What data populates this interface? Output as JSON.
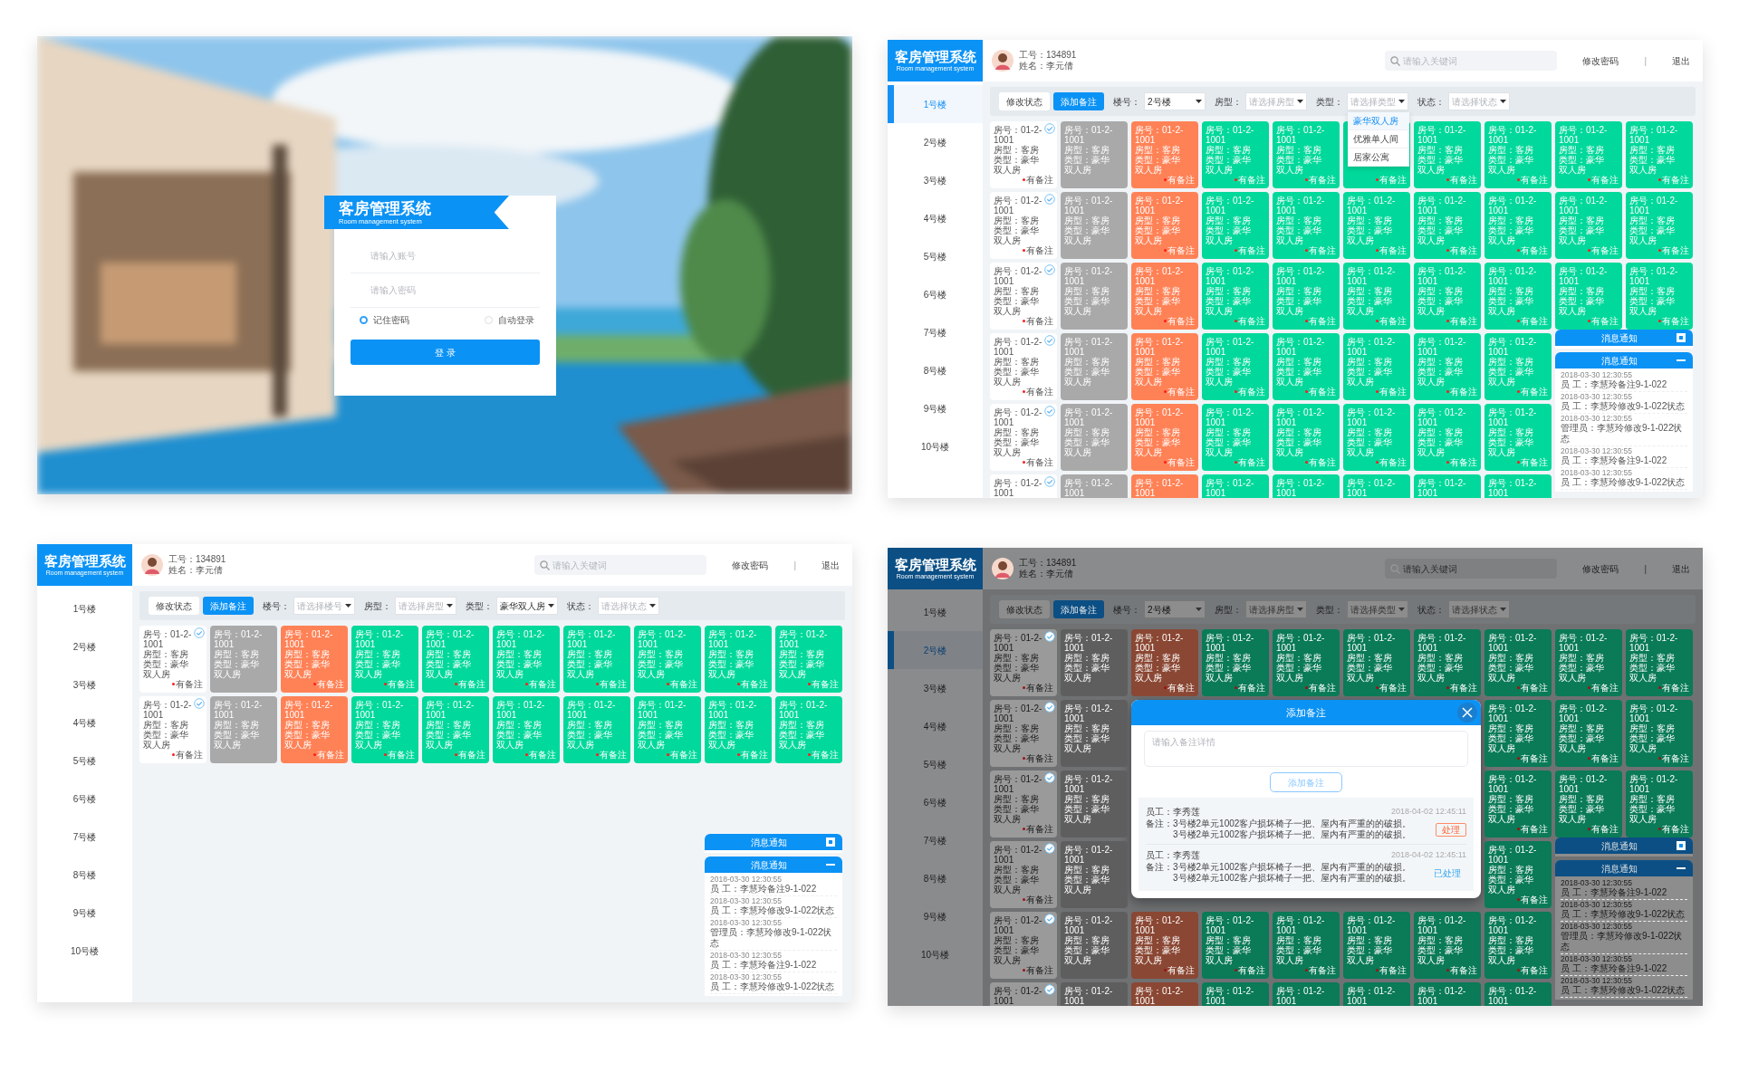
{
  "screens": [
    {
      "kind": "login",
      "title": "客房管理系统",
      "subtitle": "Room management system",
      "fields": [
        {
          "placeholder": "请输入账号"
        },
        {
          "placeholder": "请输入密码"
        }
      ],
      "options": [
        {
          "label": "记住密码",
          "checked": true
        },
        {
          "label": "自动登录",
          "checked": false
        }
      ],
      "button": "登 录"
    },
    {
      "kind": "dashboard",
      "header": {
        "title": "客房管理系统",
        "subtitle": "Room management system",
        "staff_id": "工号：134891",
        "staff_name": "姓名：李元倩",
        "search_placeholder": "请输入关键词",
        "links": [
          "修改密码",
          "|",
          "退出"
        ]
      },
      "floors": [
        {
          "label": "1号楼",
          "selected": true
        },
        {
          "label": "2号楼",
          "selected": false
        },
        {
          "label": "3号楼",
          "selected": false
        },
        {
          "label": "4号楼",
          "selected": false
        },
        {
          "label": "5号楼",
          "selected": false
        },
        {
          "label": "6号楼",
          "selected": false
        },
        {
          "label": "7号楼",
          "selected": false
        },
        {
          "label": "8号楼",
          "selected": false
        },
        {
          "label": "9号楼",
          "selected": false
        },
        {
          "label": "10号楼",
          "selected": false
        }
      ],
      "toolbar": {
        "buttons": [
          {
            "label": "修改状态",
            "primary": false
          },
          {
            "label": "添加备注",
            "primary": true
          }
        ],
        "filters": [
          {
            "label": "楼号：",
            "value": "2号楼"
          },
          {
            "label": "房型：",
            "placeholder": "请选择房型"
          },
          {
            "label": "类型：",
            "placeholder": "请选择类型",
            "options": [
              {
                "label": "豪华双人房",
                "selected": true
              },
              {
                "label": "优雅单人间",
                "selected": false
              },
              {
                "label": "居家公寓",
                "selected": false
              }
            ]
          },
          {
            "label": "状态：",
            "placeholder": "请选择状态"
          }
        ]
      },
      "rooms": [
        [
          {
            "color": "#ffffff",
            "checked": true,
            "room": "房号：01-2-1001",
            "type": "房型：客房",
            "category": "类型：豪华双人房",
            "note": "有备注"
          },
          {
            "color": "#a9a9a9",
            "checked": false,
            "room": "房号：01-2-1001",
            "type": "房型：客房",
            "category": "类型：豪华双人房"
          },
          {
            "color": "#ff8257",
            "checked": false,
            "room": "房号：01-2-1001",
            "type": "房型：客房",
            "category": "类型：豪华双人房",
            "note": "有备注"
          },
          {
            "color": "#00d99b",
            "checked": false,
            "room": "房号：01-2-1001",
            "type": "房型：客房",
            "category": "类型：豪华双人房",
            "note": "有备注"
          },
          {
            "color": "#00d99b",
            "checked": false,
            "room": "房号：01-2-1001",
            "type": "房型：客房",
            "category": "类型：豪华双人房",
            "note": "有备注"
          },
          {
            "color": "#00d99b",
            "note": "有备注"
          },
          {
            "color": "#00d99b",
            "checked": false,
            "room": "房号：01-2-1001",
            "type": "房型：客房",
            "category": "类型：豪华双人房",
            "note": "有备注"
          },
          {
            "color": "#00d99b",
            "checked": false,
            "room": "房号：01-2-1001",
            "type": "房型：客房",
            "category": "类型：豪华双人房",
            "note": "有备注"
          },
          {
            "color": "#00d99b",
            "checked": false,
            "room": "房号：01-2-1001",
            "type": "房型：客房",
            "category": "类型：豪华双人房",
            "note": "有备注"
          },
          {
            "color": "#00d99b",
            "checked": false,
            "room": "房号：01-2-1001",
            "type": "房型：客房",
            "category": "类型：豪华双人房",
            "note": "有备注"
          }
        ],
        [
          {
            "color": "#ffffff",
            "checked": true,
            "room": "房号：01-2-1001",
            "type": "房型：客房",
            "category": "类型：豪华双人房",
            "note": "有备注"
          },
          {
            "color": "#a9a9a9",
            "checked": false,
            "room": "房号：01-2-1001",
            "type": "房型：客房",
            "category": "类型：豪华双人房"
          },
          {
            "color": "#ff8257",
            "checked": false,
            "room": "房号：01-2-1001",
            "type": "房型：客房",
            "category": "类型：豪华双人房",
            "note": "有备注"
          },
          {
            "color": "#00d99b",
            "checked": false,
            "room": "房号：01-2-1001",
            "type": "房型：客房",
            "category": "类型：豪华双人房",
            "note": "有备注"
          },
          {
            "color": "#00d99b",
            "checked": false,
            "room": "房号：01-2-1001",
            "type": "房型：客房",
            "category": "类型：豪华双人房",
            "note": "有备注"
          },
          {
            "color": "#00d99b",
            "checked": false,
            "room": "房号：01-2-1001",
            "type": "房型：客房",
            "category": "类型：豪华双人房",
            "note": "有备注"
          },
          {
            "color": "#00d99b",
            "checked": false,
            "room": "房号：01-2-1001",
            "type": "房型：客房",
            "category": "类型：豪华双人房",
            "note": "有备注"
          },
          {
            "color": "#00d99b",
            "checked": false,
            "room": "房号：01-2-1001",
            "type": "房型：客房",
            "category": "类型：豪华双人房",
            "note": "有备注"
          },
          {
            "color": "#00d99b",
            "checked": false,
            "room": "房号：01-2-1001",
            "type": "房型：客房",
            "category": "类型：豪华双人房",
            "note": "有备注"
          },
          {
            "color": "#00d99b",
            "checked": false,
            "room": "房号：01-2-1001",
            "type": "房型：客房",
            "category": "类型：豪华双人房",
            "note": "有备注"
          }
        ],
        [
          {
            "color": "#ffffff",
            "checked": true,
            "room": "房号：01-2-1001",
            "type": "房型：客房",
            "category": "类型：豪华双人房",
            "note": "有备注"
          },
          {
            "color": "#a9a9a9",
            "checked": false,
            "room": "房号：01-2-1001",
            "type": "房型：客房",
            "category": "类型：豪华双人房"
          },
          {
            "color": "#ff8257",
            "checked": false,
            "room": "房号：01-2-1001",
            "type": "房型：客房",
            "category": "类型：豪华双人房",
            "note": "有备注"
          },
          {
            "color": "#00d99b",
            "checked": false,
            "room": "房号：01-2-1001",
            "type": "房型：客房",
            "category": "类型：豪华双人房",
            "note": "有备注"
          },
          {
            "color": "#00d99b",
            "checked": false,
            "room": "房号：01-2-1001",
            "type": "房型：客房",
            "category": "类型：豪华双人房",
            "note": "有备注"
          },
          {
            "color": "#00d99b",
            "checked": false,
            "room": "房号：01-2-1001",
            "type": "房型：客房",
            "category": "类型：豪华双人房",
            "note": "有备注"
          },
          {
            "color": "#00d99b",
            "checked": false,
            "room": "房号：01-2-1001",
            "type": "房型：客房",
            "category": "类型：豪华双人房",
            "note": "有备注"
          },
          {
            "color": "#00d99b",
            "checked": false,
            "room": "房号：01-2-1001",
            "type": "房型：客房",
            "category": "类型：豪华双人房",
            "note": "有备注"
          },
          {
            "color": "#00d99b",
            "checked": false,
            "room": "房号：01-2-1001",
            "type": "房型：客房",
            "category": "类型：豪华双人房",
            "note": "有备注"
          },
          {
            "color": "#00d99b",
            "checked": false,
            "room": "房号：01-2-1001",
            "type": "房型：客房",
            "category": "类型：豪华双人房",
            "note": "有备注"
          }
        ],
        [
          {
            "color": "#ffffff",
            "checked": true,
            "room": "房号：01-2-1001",
            "type": "房型：客房",
            "category": "类型：豪华双人房",
            "note": "有备注"
          },
          {
            "color": "#a9a9a9",
            "checked": false,
            "room": "房号：01-2-1001",
            "type": "房型：客房",
            "category": "类型：豪华双人房"
          },
          {
            "color": "#ff8257",
            "checked": false,
            "room": "房号：01-2-1001",
            "type": "房型：客房",
            "category": "类型：豪华双人房",
            "note": "有备注"
          },
          {
            "color": "#00d99b",
            "checked": false,
            "room": "房号：01-2-1001",
            "type": "房型：客房",
            "category": "类型：豪华双人房",
            "note": "有备注"
          },
          {
            "color": "#00d99b",
            "checked": false,
            "room": "房号：01-2-1001",
            "type": "房型：客房",
            "category": "类型：豪华双人房",
            "note": "有备注"
          },
          {
            "color": "#00d99b",
            "checked": false,
            "room": "房号：01-2-1001",
            "type": "房型：客房",
            "category": "类型：豪华双人房",
            "note": "有备注"
          },
          {
            "color": "#00d99b",
            "checked": false,
            "room": "房号：01-2-1001",
            "type": "房型：客房",
            "category": "类型：豪华双人房",
            "note": "有备注"
          },
          {
            "color": "#00d99b",
            "checked": false,
            "room": "房号：01-2-1001",
            "type": "房型：客房",
            "category": "类型：豪华双人房",
            "note": "有备注"
          }
        ],
        [
          {
            "color": "#ffffff",
            "checked": true,
            "room": "房号：01-2-1001",
            "type": "房型：客房",
            "category": "类型：豪华双人房",
            "note": "有备注"
          },
          {
            "color": "#a9a9a9",
            "checked": false,
            "room": "房号：01-2-1001",
            "type": "房型：客房",
            "category": "类型：豪华双人房"
          },
          {
            "color": "#ff8257",
            "checked": false,
            "room": "房号：01-2-1001",
            "type": "房型：客房",
            "category": "类型：豪华双人房",
            "note": "有备注"
          },
          {
            "color": "#00d99b",
            "checked": false,
            "room": "房号：01-2-1001",
            "type": "房型：客房",
            "category": "类型：豪华双人房",
            "note": "有备注"
          },
          {
            "color": "#00d99b",
            "checked": false,
            "room": "房号：01-2-1001",
            "type": "房型：客房",
            "category": "类型：豪华双人房",
            "note": "有备注"
          },
          {
            "color": "#00d99b",
            "checked": false,
            "room": "房号：01-2-1001",
            "type": "房型：客房",
            "category": "类型：豪华双人房",
            "note": "有备注"
          },
          {
            "color": "#00d99b",
            "checked": false,
            "room": "房号：01-2-1001",
            "type": "房型：客房",
            "category": "类型：豪华双人房",
            "note": "有备注"
          },
          {
            "color": "#00d99b",
            "checked": false,
            "room": "房号：01-2-1001",
            "type": "房型：客房",
            "category": "类型：豪华双人房",
            "note": "有备注"
          }
        ],
        [
          {
            "color": "#ffffff",
            "checked": true,
            "room": "房号：01-2-1001"
          },
          {
            "color": "#a9a9a9",
            "checked": false,
            "room": "房号：01-2-1001"
          },
          {
            "color": "#ff8257",
            "checked": false,
            "room": "房号：01-2-1001"
          },
          {
            "color": "#00d99b",
            "checked": false,
            "room": "房号：01-2-1001"
          },
          {
            "color": "#00d99b",
            "checked": false,
            "room": "房号：01-2-1001"
          },
          {
            "color": "#00d99b",
            "checked": false,
            "room": "房号：01-2-1001"
          },
          {
            "color": "#00d99b",
            "checked": false,
            "room": "房号：01-2-1001"
          },
          {
            "color": "#00d99b",
            "checked": false,
            "room": "房号：01-2-1001"
          }
        ]
      ],
      "notices": [
        {
          "title": "消息通知",
          "expanded": false
        },
        {
          "title": "消息通知",
          "expanded": true,
          "entries": [
            {
              "time": "2018-03-30 12:30:55",
              "text": "员 工：李慧玲备注9-1-022"
            },
            {
              "time": "2018-03-30 12:30:55",
              "text": "员 工：李慧玲修改9-1-022状态"
            },
            {
              "time": "2018-03-30 12:30:55",
              "text": "管理员：李慧玲修改9-1-022状态"
            },
            {
              "time": "2018-03-30 12:30:55",
              "text": "员 工：李慧玲备注9-1-022"
            },
            {
              "time": "2018-03-30 12:30:55",
              "text": "员 工：李慧玲修改9-1-022状态"
            }
          ]
        }
      ]
    },
    {
      "kind": "dashboard",
      "header": {
        "title": "客房管理系统",
        "subtitle": "Room management system",
        "staff_id": "工号：134891",
        "staff_name": "姓名：李元倩",
        "search_placeholder": "请输入关键词",
        "links": [
          "修改密码",
          "|",
          "退出"
        ]
      },
      "floors": [
        {
          "label": "1号楼",
          "selected": false
        },
        {
          "label": "2号楼",
          "selected": false
        },
        {
          "label": "3号楼",
          "selected": false
        },
        {
          "label": "4号楼",
          "selected": false
        },
        {
          "label": "5号楼",
          "selected": false
        },
        {
          "label": "6号楼",
          "selected": false
        },
        {
          "label": "7号楼",
          "selected": false
        },
        {
          "label": "8号楼",
          "selected": false
        },
        {
          "label": "9号楼",
          "selected": false
        },
        {
          "label": "10号楼",
          "selected": false
        }
      ],
      "toolbar": {
        "buttons": [
          {
            "label": "修改状态",
            "primary": false
          },
          {
            "label": "添加备注",
            "primary": true
          }
        ],
        "filters": [
          {
            "label": "楼号：",
            "placeholder": "请选择楼号"
          },
          {
            "label": "房型：",
            "placeholder": "请选择房型"
          },
          {
            "label": "类型：",
            "value": "豪华双人房"
          },
          {
            "label": "状态：",
            "placeholder": "请选择状态"
          }
        ]
      },
      "rooms": [
        [
          {
            "color": "#ffffff",
            "checked": true,
            "room": "房号：01-2-1001",
            "type": "房型：客房",
            "category": "类型：豪华双人房",
            "note": "有备注"
          },
          {
            "color": "#a9a9a9",
            "checked": false,
            "room": "房号：01-2-1001",
            "type": "房型：客房",
            "category": "类型：豪华双人房"
          },
          {
            "color": "#ff8257",
            "checked": false,
            "room": "房号：01-2-1001",
            "type": "房型：客房",
            "category": "类型：豪华双人房",
            "note": "有备注"
          },
          {
            "color": "#00d99b",
            "checked": false,
            "room": "房号：01-2-1001",
            "type": "房型：客房",
            "category": "类型：豪华双人房",
            "note": "有备注"
          },
          {
            "color": "#00d99b",
            "checked": false,
            "room": "房号：01-2-1001",
            "type": "房型：客房",
            "category": "类型：豪华双人房",
            "note": "有备注"
          },
          {
            "color": "#00d99b",
            "checked": false,
            "room": "房号：01-2-1001",
            "type": "房型：客房",
            "category": "类型：豪华双人房",
            "note": "有备注"
          },
          {
            "color": "#00d99b",
            "checked": false,
            "room": "房号：01-2-1001",
            "type": "房型：客房",
            "category": "类型：豪华双人房",
            "note": "有备注"
          },
          {
            "color": "#00d99b",
            "checked": false,
            "room": "房号：01-2-1001",
            "type": "房型：客房",
            "category": "类型：豪华双人房",
            "note": "有备注"
          },
          {
            "color": "#00d99b",
            "checked": false,
            "room": "房号：01-2-1001",
            "type": "房型：客房",
            "category": "类型：豪华双人房",
            "note": "有备注"
          },
          {
            "color": "#00d99b",
            "checked": false,
            "room": "房号：01-2-1001",
            "type": "房型：客房",
            "category": "类型：豪华双人房",
            "note": "有备注"
          }
        ],
        [
          {
            "color": "#ffffff",
            "checked": true,
            "room": "房号：01-2-1001",
            "type": "房型：客房",
            "category": "类型：豪华双人房",
            "note": "有备注"
          },
          {
            "color": "#a9a9a9",
            "checked": false,
            "room": "房号：01-2-1001",
            "type": "房型：客房",
            "category": "类型：豪华双人房"
          },
          {
            "color": "#ff8257",
            "checked": false,
            "room": "房号：01-2-1001",
            "type": "房型：客房",
            "category": "类型：豪华双人房",
            "note": "有备注"
          },
          {
            "color": "#00d99b",
            "checked": false,
            "room": "房号：01-2-1001",
            "type": "房型：客房",
            "category": "类型：豪华双人房",
            "note": "有备注"
          },
          {
            "color": "#00d99b",
            "checked": false,
            "room": "房号：01-2-1001",
            "type": "房型：客房",
            "category": "类型：豪华双人房",
            "note": "有备注"
          },
          {
            "color": "#00d99b",
            "checked": false,
            "room": "房号：01-2-1001",
            "type": "房型：客房",
            "category": "类型：豪华双人房",
            "note": "有备注"
          },
          {
            "color": "#00d99b",
            "checked": false,
            "room": "房号：01-2-1001",
            "type": "房型：客房",
            "category": "类型：豪华双人房",
            "note": "有备注"
          },
          {
            "color": "#00d99b",
            "checked": false,
            "room": "房号：01-2-1001",
            "type": "房型：客房",
            "category": "类型：豪华双人房",
            "note": "有备注"
          },
          {
            "color": "#00d99b",
            "checked": false,
            "room": "房号：01-2-1001",
            "type": "房型：客房",
            "category": "类型：豪华双人房",
            "note": "有备注"
          },
          {
            "color": "#00d99b",
            "checked": false,
            "room": "房号：01-2-1001",
            "type": "房型：客房",
            "category": "类型：豪华双人房",
            "note": "有备注"
          }
        ]
      ],
      "notices": [
        {
          "title": "消息通知",
          "expanded": false
        },
        {
          "title": "消息通知",
          "expanded": true,
          "entries": [
            {
              "time": "2018-03-30 12:30:55",
              "text": "员 工：李慧玲备注9-1-022"
            },
            {
              "time": "2018-03-30 12:30:55",
              "text": "员 工：李慧玲修改9-1-022状态"
            },
            {
              "time": "2018-03-30 12:30:55",
              "text": "管理员：李慧玲修改9-1-022状态"
            },
            {
              "time": "2018-03-30 12:30:55",
              "text": "员 工：李慧玲备注9-1-022"
            },
            {
              "time": "2018-03-30 12:30:55",
              "text": "员 工：李慧玲修改9-1-022状态"
            }
          ]
        }
      ]
    },
    {
      "kind": "dashboard",
      "dimmed": true,
      "header": {
        "title": "客房管理系统",
        "subtitle": "Room management system",
        "staff_id": "工号：134891",
        "staff_name": "姓名：李元倩",
        "search_placeholder": "请输入关键词",
        "links": [
          "修改密码",
          "|",
          "退出"
        ]
      },
      "floors": [
        {
          "label": "1号楼",
          "selected": false
        },
        {
          "label": "2号楼",
          "selected": true
        },
        {
          "label": "3号楼",
          "selected": false
        },
        {
          "label": "4号楼",
          "selected": false
        },
        {
          "label": "5号楼",
          "selected": false
        },
        {
          "label": "6号楼",
          "selected": false
        },
        {
          "label": "7号楼",
          "selected": false
        },
        {
          "label": "8号楼",
          "selected": false
        },
        {
          "label": "9号楼",
          "selected": false
        },
        {
          "label": "10号楼",
          "selected": false
        }
      ],
      "toolbar": {
        "buttons": [
          {
            "label": "修改状态",
            "primary": false
          },
          {
            "label": "添加备注",
            "primary": true
          }
        ],
        "filters": [
          {
            "label": "楼号：",
            "value": "2号楼"
          },
          {
            "label": "房型：",
            "placeholder": "请选择房型"
          },
          {
            "label": "类型：",
            "placeholder": "请选择类型"
          },
          {
            "label": "状态：",
            "placeholder": "请选择状态"
          }
        ]
      },
      "rooms": [
        [
          {
            "color": "#9a9a9a",
            "checked": true,
            "room": "房号：01-2-1001",
            "type": "房型：客房",
            "category": "类型：豪华双人房",
            "note": "有备注"
          },
          {
            "color": "#5e5e5e",
            "checked": false,
            "room": "房号：01-2-1001",
            "type": "房型：客房",
            "category": "类型：豪华双人房"
          },
          {
            "color": "#8a4733",
            "checked": false,
            "room": "房号：01-2-1001",
            "type": "房型：客房",
            "category": "类型：豪华双人房",
            "note": "有备注"
          },
          {
            "color": "#0a7a57",
            "checked": false,
            "room": "房号：01-2-1001",
            "type": "房型：客房",
            "category": "类型：豪华双人房",
            "note": "有备注"
          },
          {
            "color": "#0a7a57",
            "checked": false,
            "room": "房号：01-2-1001",
            "type": "房型：客房",
            "category": "类型：豪华双人房",
            "note": "有备注"
          },
          {
            "color": "#0a7a57",
            "checked": false,
            "room": "房号：01-2-1001",
            "type": "房型：客房",
            "category": "类型：豪华双人房",
            "note": "有备注"
          },
          {
            "color": "#0a7a57",
            "checked": false,
            "room": "房号：01-2-1001",
            "type": "房型：客房",
            "category": "类型：豪华双人房",
            "note": "有备注"
          },
          {
            "color": "#0a7a57",
            "checked": false,
            "room": "房号：01-2-1001",
            "type": "房型：客房",
            "category": "类型：豪华双人房",
            "note": "有备注"
          },
          {
            "color": "#0a7a57",
            "checked": false,
            "room": "房号：01-2-1001",
            "type": "房型：客房",
            "category": "类型：豪华双人房",
            "note": "有备注"
          },
          {
            "color": "#0a7a57",
            "checked": false,
            "room": "房号：01-2-1001",
            "type": "房型：客房",
            "category": "类型：豪华双人房",
            "note": "有备注"
          }
        ],
        [
          {
            "color": "#9a9a9a",
            "checked": true,
            "room": "房号：01-2-1001",
            "type": "房型：客房",
            "category": "类型：豪华双人房",
            "note": "有备注"
          },
          {
            "color": "#5e5e5e",
            "checked": false,
            "room": "房号：01-2-1001",
            "type": "房型：客房",
            "category": "类型：豪华双人房"
          },
          {
            "color": "#0a7a57",
            "checked": false,
            "room": "房号：01-2-1001",
            "type": "房型：客房",
            "category": "类型：豪华双人房",
            "note": "有备注"
          },
          {
            "color": "#0a7a57",
            "checked": false,
            "room": "房号：01-2-1001",
            "type": "房型：客房",
            "category": "类型：豪华双人房",
            "note": "有备注"
          },
          {
            "color": "#0a7a57",
            "checked": false,
            "room": "房号：01-2-1001",
            "type": "房型：客房",
            "category": "类型：豪华双人房",
            "note": "有备注"
          }
        ],
        [
          {
            "color": "#9a9a9a",
            "checked": true,
            "room": "房号：01-2-1001",
            "type": "房型：客房",
            "category": "类型：豪华双人房",
            "note": "有备注"
          },
          {
            "color": "#5e5e5e",
            "checked": false,
            "room": "房号：01-2-1001",
            "type": "房型：客房",
            "category": "类型：豪华双人房"
          },
          {
            "color": "#0a7a57",
            "checked": false,
            "room": "房号：01-2-1001",
            "type": "房型：客房",
            "category": "类型：豪华双人房",
            "note": "有备注"
          },
          {
            "color": "#0a7a57",
            "checked": false,
            "room": "房号：01-2-1001",
            "type": "房型：客房",
            "category": "类型：豪华双人房",
            "note": "有备注"
          },
          {
            "color": "#0a7a57",
            "checked": false,
            "room": "房号：01-2-1001",
            "type": "房型：客房",
            "category": "类型：豪华双人房",
            "note": "有备注"
          }
        ],
        [
          {
            "color": "#9a9a9a",
            "checked": true,
            "room": "房号：01-2-1001",
            "type": "房型：客房",
            "category": "类型：豪华双人房",
            "note": "有备注"
          },
          {
            "color": "#5e5e5e",
            "checked": false,
            "room": "房号：01-2-1001",
            "type": "房型：客房",
            "category": "类型：豪华双人房"
          },
          {
            "color": "#0a7a57",
            "checked": false,
            "room": "房号：01-2-1001",
            "type": "房型：客房",
            "category": "类型：豪华双人房",
            "note": "有备注"
          }
        ],
        [
          {
            "color": "#9a9a9a",
            "checked": true,
            "room": "房号：01-2-1001",
            "type": "房型：客房",
            "category": "类型：豪华双人房",
            "note": "有备注"
          },
          {
            "color": "#5e5e5e",
            "checked": false,
            "room": "房号：01-2-1001",
            "type": "房型：客房",
            "category": "类型：豪华双人房"
          },
          {
            "color": "#8a4733",
            "checked": false,
            "room": "房号：01-2-1001",
            "type": "房型：客房",
            "category": "类型：豪华双人房",
            "note": "有备注"
          },
          {
            "color": "#0a7a57",
            "checked": false,
            "room": "房号：01-2-1001",
            "type": "房型：客房",
            "category": "类型：豪华双人房",
            "note": "有备注"
          },
          {
            "color": "#0a7a57",
            "checked": false,
            "room": "房号：01-2-1001",
            "type": "房型：客房",
            "category": "类型：豪华双人房",
            "note": "有备注"
          },
          {
            "color": "#0a7a57",
            "checked": false,
            "room": "房号：01-2-1001",
            "type": "房型：客房",
            "category": "类型：豪华双人房",
            "note": "有备注"
          },
          {
            "color": "#0a7a57",
            "checked": false,
            "room": "房号：01-2-1001",
            "type": "房型：客房",
            "category": "类型：豪华双人房",
            "note": "有备注"
          },
          {
            "color": "#0a7a57",
            "checked": false,
            "room": "房号：01-2-1001",
            "type": "房型：客房",
            "category": "类型：豪华双人房",
            "note": "有备注"
          }
        ],
        [
          {
            "color": "#9a9a9a",
            "checked": true,
            "room": "房号：01-2-1001"
          },
          {
            "color": "#5e5e5e",
            "checked": false,
            "room": "房号：01-2-1001"
          },
          {
            "color": "#8a4733",
            "checked": false,
            "room": "房号：01-2-1001"
          },
          {
            "color": "#0a7a57",
            "checked": false,
            "room": "房号：01-2-1001"
          },
          {
            "color": "#0a7a57",
            "checked": false,
            "room": "房号：01-2-1001"
          },
          {
            "color": "#0a7a57",
            "checked": false,
            "room": "房号：01-2-1001"
          },
          {
            "color": "#0a7a57",
            "checked": false,
            "room": "房号：01-2-1001"
          },
          {
            "color": "#0a7a57",
            "checked": false,
            "room": "房号：01-2-1001"
          }
        ]
      ],
      "notices": [
        {
          "title": "消息通知",
          "expanded": false
        },
        {
          "title": "消息通知",
          "expanded": true,
          "entries": [
            {
              "time": "2018-03-30 12:30:55",
              "text": "员 工：李慧玲备注9-1-022"
            },
            {
              "time": "2018-03-30 12:30:55",
              "text": "员 工：李慧玲修改9-1-022状态"
            },
            {
              "time": "2018-03-30 12:30:55",
              "text": "管理员：李慧玲修改9-1-022状态"
            },
            {
              "time": "2018-03-30 12:30:55",
              "text": "员 工：李慧玲备注9-1-022"
            },
            {
              "time": "2018-03-30 12:30:55",
              "text": "员 工：李慧玲修改9-1-022状态"
            }
          ]
        }
      ],
      "modal": {
        "title": "添加备注",
        "placeholder": "请输入备注详情",
        "button": "添加备注",
        "entries": [
          {
            "employee": "员工：李秀莲",
            "time": "2018-04-02 12:45:11",
            "lines": [
              "备注：3号楼2单元1002客户损坏椅子一把、屋内有严重的的破损。",
              "3号楼2单元1002客户损坏椅子一把、屋内有严重的的破损。"
            ],
            "action": "处理",
            "handled": false
          },
          {
            "employee": "员工：李秀莲",
            "time": "2018-04-02 12:45:11",
            "lines": [
              "备注：3号楼2单元1002客户损坏椅子一把、屋内有严重的的破损。",
              "3号楼2单元1002客户损坏椅子一把、屋内有严重的的破损。"
            ],
            "action": "已处理",
            "handled": true
          }
        ]
      }
    }
  ]
}
